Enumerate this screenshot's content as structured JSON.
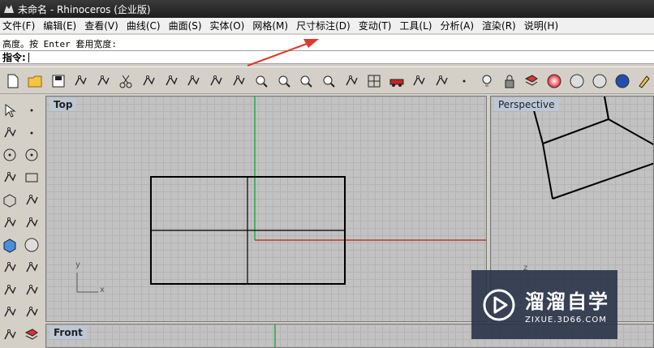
{
  "window": {
    "title": "未命名 - Rhinoceros (企业版)"
  },
  "menu": [
    "文件(F)",
    "编辑(E)",
    "查看(V)",
    "曲线(C)",
    "曲面(S)",
    "实体(O)",
    "网格(M)",
    "尺寸标注(D)",
    "变动(T)",
    "工具(L)",
    "分析(A)",
    "渲染(R)",
    "说明(H)"
  ],
  "command": {
    "history": "高度。按 Enter 套用宽度:",
    "prompt": "指令:",
    "value": ""
  },
  "toolbar_icons": [
    "new-file-icon",
    "open-folder-icon",
    "save-icon",
    "print-icon",
    "import-icon",
    "cut-icon",
    "copy-icon",
    "paste-icon",
    "undo-icon",
    "pan-hand-icon",
    "rotate-view-icon",
    "zoom-dynamic-icon",
    "zoom-window-icon",
    "zoom-extents-icon",
    "zoom-selected-icon",
    "undo-view-icon",
    "four-viewports-icon",
    "car-icon",
    "grid-plane-icon",
    "osnap-icon",
    "points-icon",
    "light-bulb-icon",
    "lock-icon",
    "layer-icon",
    "color-wheel-icon",
    "wireframe-sphere-icon",
    "render-sphere-grid-icon",
    "render-sphere-icon",
    "pencil-icon"
  ],
  "left_tools": [
    [
      "select-arrow-icon",
      "point-icon"
    ],
    [
      "polyline-icon",
      "curve-points-icon"
    ],
    [
      "circle-icon",
      "ellipse-icon"
    ],
    [
      "arc-icon",
      "rectangle-icon"
    ],
    [
      "polygon-icon",
      "fillet-curve-icon"
    ],
    [
      "surface-icon",
      "revolve-icon"
    ],
    [
      "box-icon",
      "sphere-group-icon"
    ],
    [
      "cylinder-icon",
      "mesh-plane-icon"
    ],
    [
      "gear-transform-icon",
      "split-icon"
    ],
    [
      "dimension-icon",
      "text-icon"
    ],
    [
      "group-icon",
      "layer-small-icon"
    ]
  ],
  "viewports": {
    "top": {
      "label": "Top",
      "axis_y": "y",
      "axis_x": "x"
    },
    "perspective": {
      "label": "Perspective",
      "axis_z": "z"
    },
    "front": {
      "label": "Front"
    }
  },
  "colors": {
    "x_axis": "#c0392b",
    "y_axis": "#27a844",
    "annotation_arrow": "#e0392b",
    "viewport_bg": "#c2c2c2"
  },
  "watermark": {
    "brand": "溜溜自学",
    "url": "ZIXUE.3D66.COM"
  }
}
